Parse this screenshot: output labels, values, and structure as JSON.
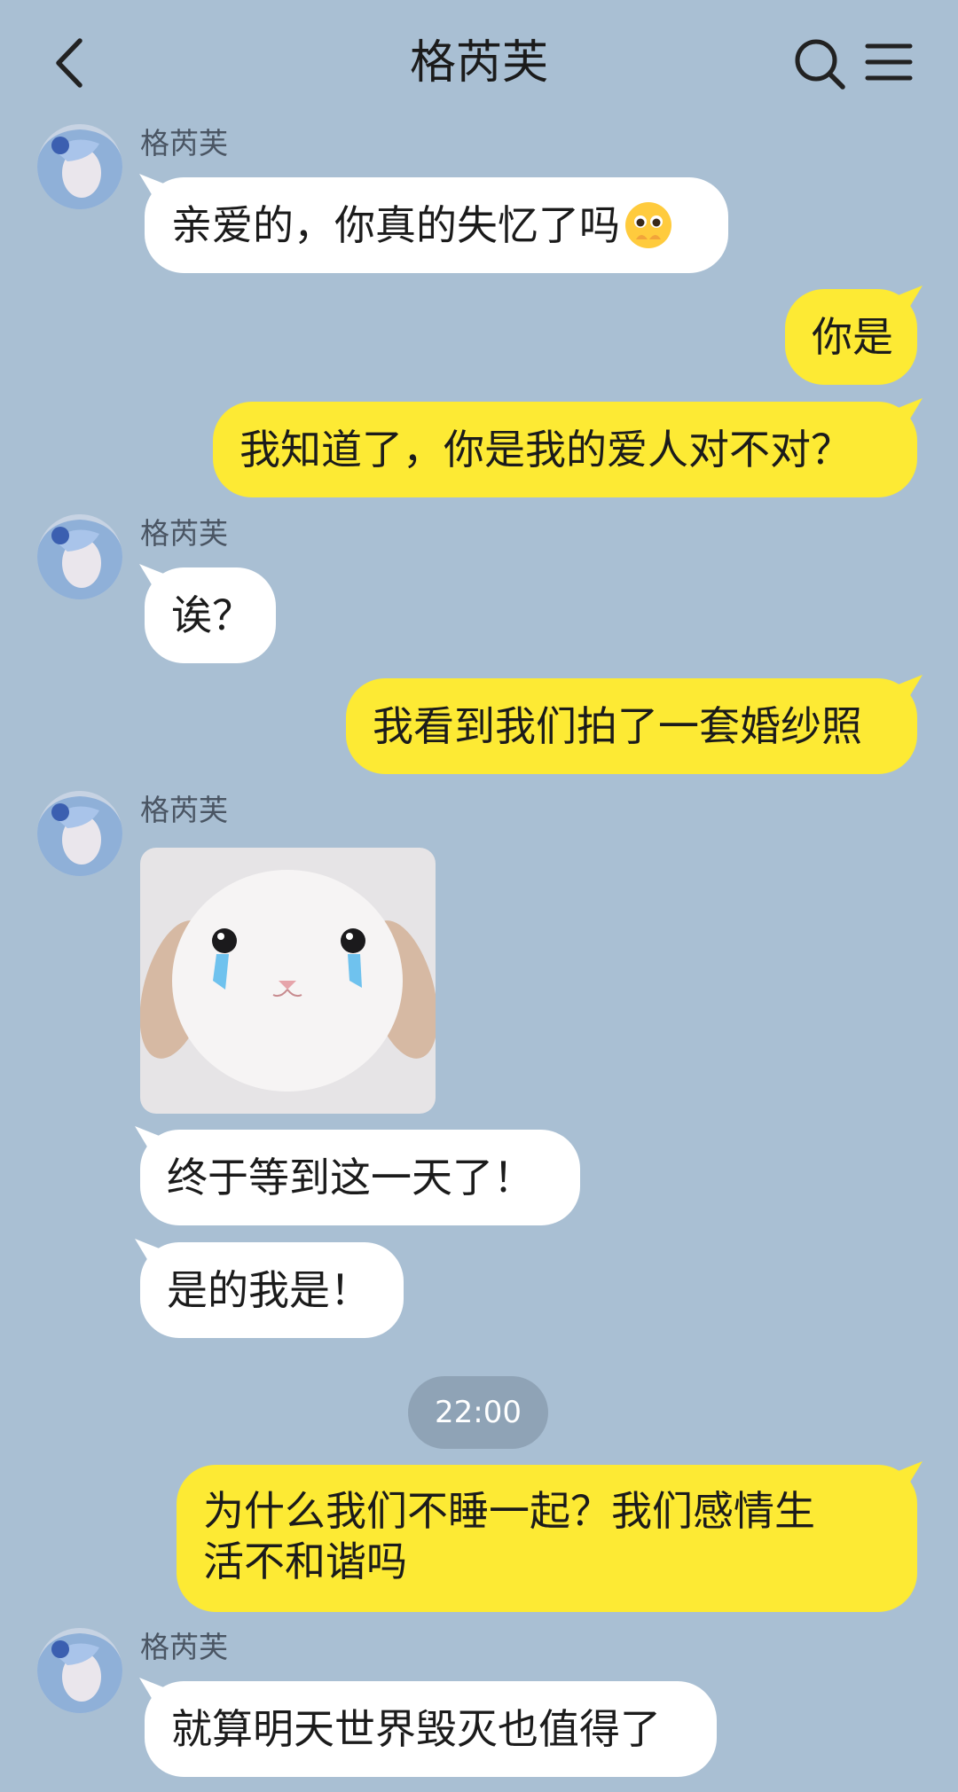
{
  "header": {
    "title": "格芮芙",
    "back_icon": "chevron-left-icon",
    "search_icon": "search-icon",
    "menu_icon": "hamburger-menu-icon"
  },
  "contact": {
    "name": "格芮芙",
    "avatar_icon": "avatar"
  },
  "messages": [
    {
      "side": "in",
      "sender": "格芮芙",
      "text": "亲爱的，你真的失忆了吗",
      "emoji": "pleading-face-emoji"
    },
    {
      "side": "out",
      "text": "你是"
    },
    {
      "side": "out",
      "text": "我知道了，你是我的爱人对不对？"
    },
    {
      "side": "in",
      "sender": "格芮芙",
      "text": "诶？"
    },
    {
      "side": "out",
      "text": "我看到我们拍了一套婚纱照"
    },
    {
      "side": "in",
      "sender": "格芮芙",
      "sticker": "crying-bunny-sticker"
    },
    {
      "side": "in",
      "text": "终于等到这一天了！"
    },
    {
      "side": "in",
      "text": "是的我是！"
    },
    {
      "type": "time",
      "text": "22:00"
    },
    {
      "side": "out",
      "text_line1": "为什么我们不睡一起？我们感情生",
      "text_line2": "活不和谐吗"
    },
    {
      "side": "in",
      "sender": "格芮芙",
      "text": "就算明天世界毁灭也值得了"
    }
  ],
  "colors": {
    "background": "#a9bfd3",
    "incoming_bubble": "#ffffff",
    "outgoing_bubble": "#fdea34",
    "time_pill": "#8fa3b6"
  }
}
